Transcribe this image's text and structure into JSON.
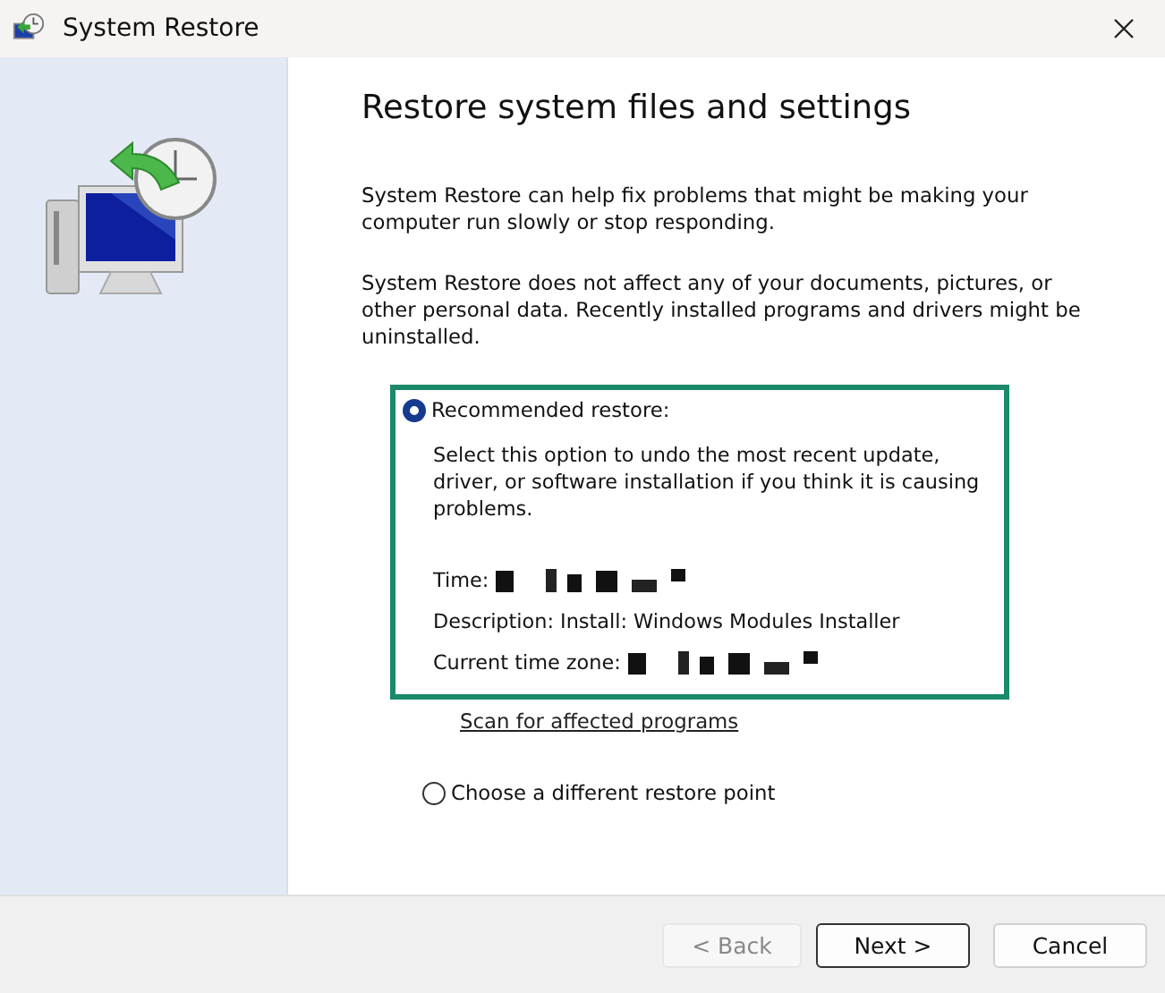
{
  "window": {
    "title": "System Restore"
  },
  "heading": "Restore system files and settings",
  "paragraphs": [
    "System Restore can help fix problems that might be making your computer run slowly or stop responding.",
    "System Restore does not affect any of your documents, pictures, or other personal data. Recently installed programs and drivers might be uninstalled."
  ],
  "options": [
    {
      "label": "Recommended restore:",
      "selected": true,
      "highlighted": true,
      "description": "Select this option to undo the most recent update, driver, or software installation if you think it is causing problems.",
      "details": [
        {
          "label": "Time:",
          "redacted": true
        },
        {
          "label": "Description: Install: Windows Modules Installer",
          "redacted": false
        },
        {
          "label": "Current time zone:",
          "redacted": true
        }
      ],
      "link": "Scan for affected programs"
    },
    {
      "label": "Choose a different restore point",
      "selected": false,
      "highlighted": false
    }
  ],
  "buttons": [
    {
      "label": "< Back",
      "disabled": true,
      "default": false
    },
    {
      "label": "Next >",
      "disabled": false,
      "default": true
    },
    {
      "label": "Cancel",
      "disabled": false,
      "default": false
    }
  ]
}
